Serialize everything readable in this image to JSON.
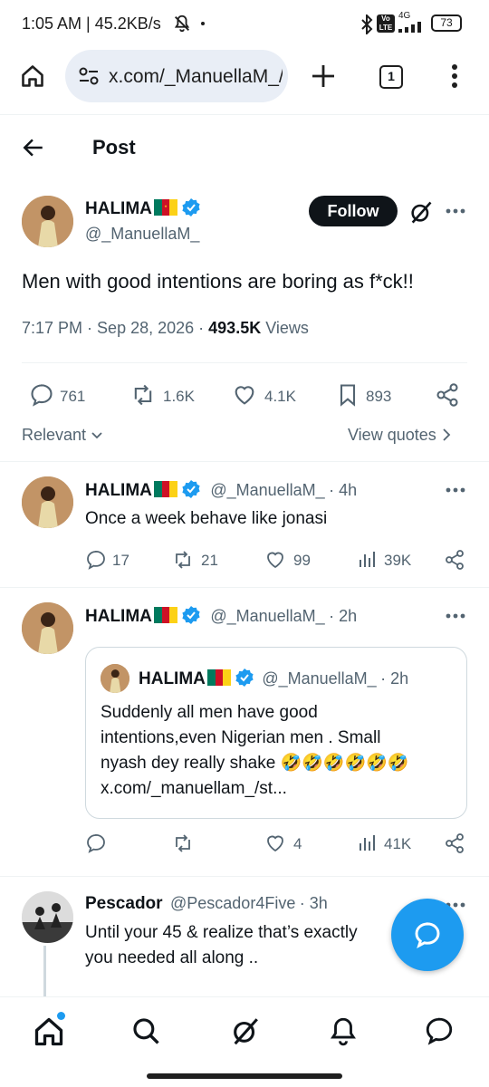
{
  "status_bar": {
    "time_speed": "1:05 AM | 45.2KB/s",
    "network": "4G",
    "battery": "73"
  },
  "browser": {
    "url": "x.com/_ManuellaM_/s",
    "tab_count": "1"
  },
  "header": {
    "title": "Post"
  },
  "main_post": {
    "author_name": "HALIMA",
    "author_handle": "@_ManuellaM_",
    "follow_label": "Follow",
    "text": "Men with good intentions are boring as f*ck!!",
    "time": "7:17 PM",
    "date": "Sep 28, 2026",
    "views_count": "493.5K",
    "views_label": "Views",
    "replies": "761",
    "reposts": "1.6K",
    "likes": "4.1K",
    "bookmarks": "893"
  },
  "filters": {
    "sort_label": "Relevant",
    "view_quotes_label": "View quotes"
  },
  "replies": [
    {
      "name": "HALIMA",
      "handle": "@_ManuellaM_",
      "time": "· 4h",
      "text": "Once a week behave like jonasi",
      "replies": "17",
      "reposts": "21",
      "likes": "99",
      "views": "39K"
    },
    {
      "name": "HALIMA",
      "handle": "@_ManuellaM_",
      "time": "· 2h",
      "quote": {
        "name": "HALIMA",
        "handle": "@_ManuellaM_",
        "time": "· 2h",
        "line1": "Suddenly all men have good",
        "line2": "intentions,even Nigerian men . Small",
        "line3": "nyash dey really shake 🤣🤣🤣🤣🤣🤣",
        "line4": "x.com/_manuellam_/st..."
      },
      "replies": "",
      "reposts": "",
      "likes": "4",
      "views": "41K"
    },
    {
      "name": "Pescador",
      "handle": "@Pescador4Five",
      "time": "· 3h",
      "line1": "Until your 45 & realize that’s exactly",
      "line2": "you needed all along .."
    }
  ],
  "colors": {
    "accent": "#1d9bf0",
    "text": "#0f1419",
    "secondary": "#536471",
    "flag_green": "#007a5e",
    "flag_red": "#ce1126",
    "flag_yellow": "#fcd116"
  },
  "icons": [
    "home-icon",
    "search-icon",
    "grok-icon",
    "bell-icon",
    "messages-icon",
    "reply-icon",
    "repost-icon",
    "like-icon",
    "bookmark-icon",
    "share-icon",
    "views-icon",
    "verified-icon",
    "more-icon"
  ]
}
